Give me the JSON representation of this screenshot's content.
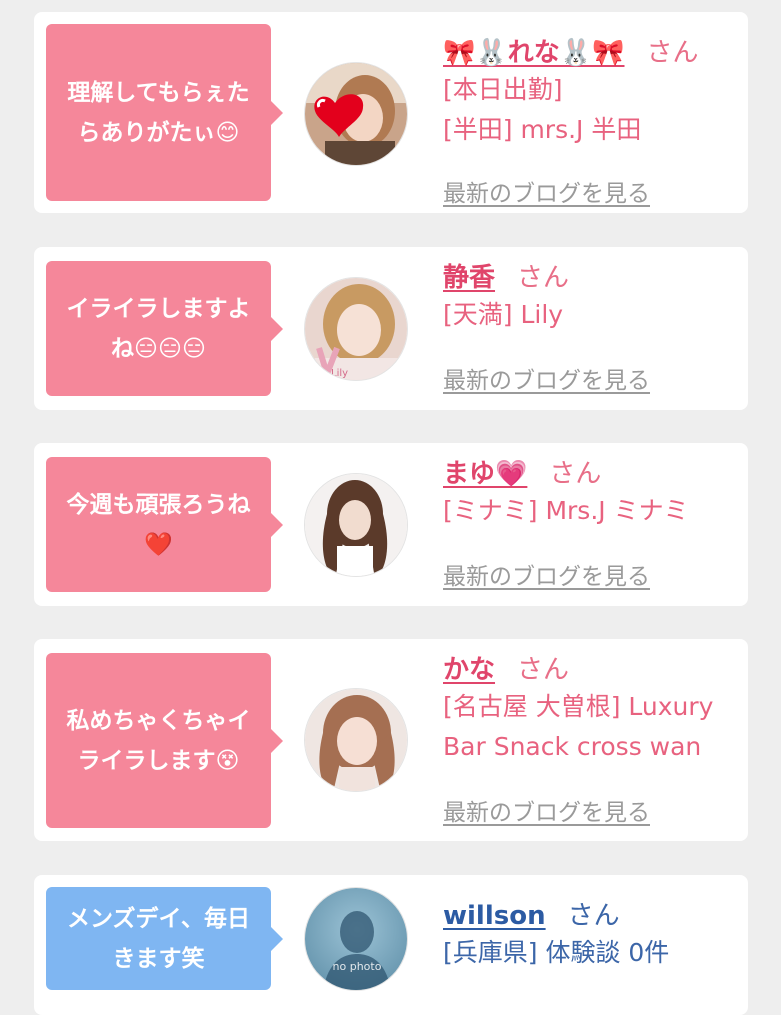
{
  "colors": {
    "pink_bubble": "#f5879a",
    "blue_bubble": "#7fb6f2",
    "name_pink": "#e0456b",
    "name_blue": "#2c5ba3",
    "detail_pink": "#e8627f",
    "link_gray": "#9a9a9a"
  },
  "honorific": "さん",
  "blog_link_label": "最新のブログを見る",
  "cards": [
    {
      "comment": "理解してもらぇたらありがたぃ😊",
      "name": "🎀🐰れな🐰🎀",
      "lines": [
        "[本日出勤]",
        "[半田] mrs.J 半田"
      ],
      "avatar_icon": "woman-photo-heart-sticker"
    },
    {
      "comment": "イライラしますよね😑😑😑",
      "name": "静香",
      "lines": [
        "[天満] Lily"
      ],
      "avatar_icon": "woman-photo"
    },
    {
      "comment": "今週も頑張ろうね❤️",
      "name": "まゆ💗",
      "lines": [
        "[ミナミ] Mrs.J ミナミ"
      ],
      "avatar_icon": "woman-photo"
    },
    {
      "comment": "私めちゃくちゃイライラします😵",
      "name": "かな",
      "lines": [
        "[名古屋 大曽根] Luxury Bar Snack cross wan"
      ],
      "avatar_icon": "woman-photo"
    },
    {
      "comment": "メンズデイ、毎日きます笑",
      "name": "willson",
      "lines": [
        "[兵庫県] 体験談 0件"
      ],
      "avatar_icon": "no-photo-silhouette",
      "avatar_text": "no photo"
    }
  ]
}
